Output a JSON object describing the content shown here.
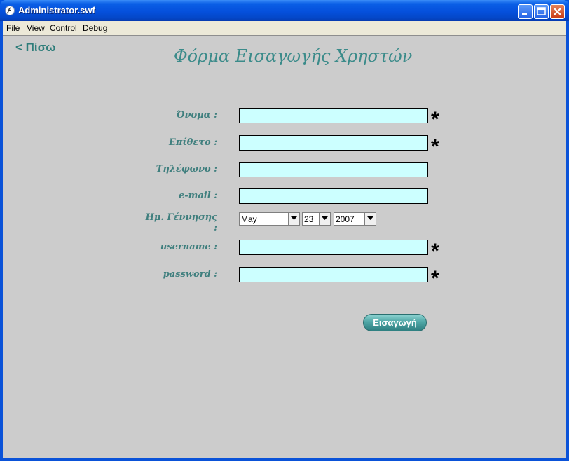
{
  "window": {
    "title": "Administrator.swf",
    "menu": [
      {
        "label": "File",
        "underline": "F",
        "rest": "ile"
      },
      {
        "label": "View",
        "underline": "V",
        "rest": "iew"
      },
      {
        "label": "Control",
        "underline": "C",
        "rest": "ontrol"
      },
      {
        "label": "Debug",
        "underline": "D",
        "rest": "ebug"
      }
    ]
  },
  "page": {
    "back_link": "< Πίσω",
    "title": "Φόρμα Εισαγωγής Χρηστών"
  },
  "form": {
    "first_name_label": "Όνομα :",
    "last_name_label": "Επίθετο :",
    "phone_label": "Τηλέφωνο :",
    "email_label": "e-mail  :",
    "birthdate_label": "Ημ. Γέννησης :",
    "username_label": "username :",
    "password_label": "password :",
    "required_mark": "*",
    "birth_month": "May",
    "birth_day": "23",
    "birth_year": "2007",
    "submit_label": "Εισαγωγή"
  },
  "colors": {
    "accent": "#3b8b8a",
    "field_bg": "#ccffff",
    "content_bg": "#cccccc"
  }
}
